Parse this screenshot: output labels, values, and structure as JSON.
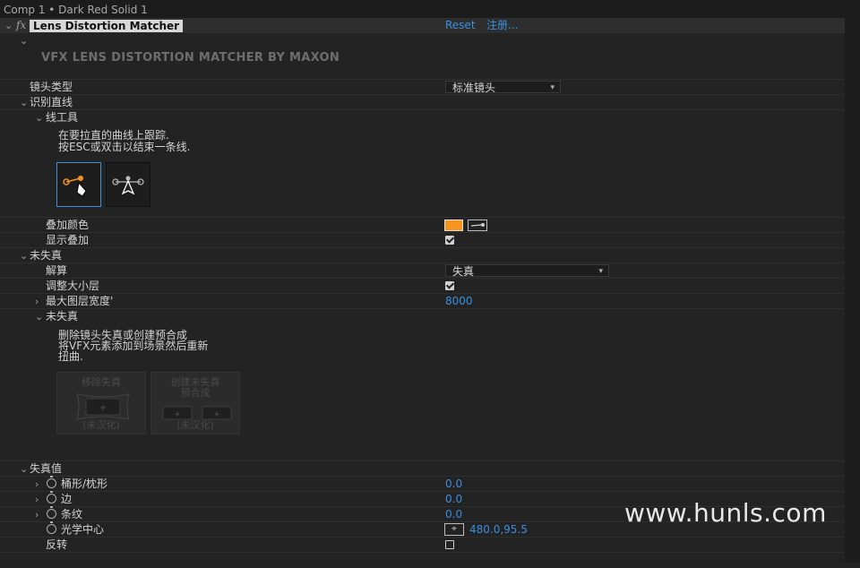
{
  "window": {
    "title": "Comp 1 • Dark Red Solid 1"
  },
  "effect": {
    "fx_icon": "fx",
    "name": "Lens Distortion Matcher",
    "reset": "Reset",
    "register": "注册...",
    "brand": "VFX LENS DISTORTION MATCHER BY MAXON"
  },
  "lens_type": {
    "label": "镜头类型",
    "value": "标准镜头"
  },
  "identify_lines": {
    "label": "识别直线",
    "line_tool": {
      "label": "线工具",
      "instr1": "在要拉直的曲线上跟踪.",
      "instr2": "按ESC或双击以结束一条线."
    },
    "overlay_color": {
      "label": "叠加颜色",
      "color": "#f7941d"
    },
    "show_overlay": {
      "label": "显示叠加",
      "checked": true
    }
  },
  "undistort": {
    "label": "未失真",
    "solve": {
      "label": "解算",
      "value": "失真"
    },
    "resize_layer": {
      "label": "调整大小层",
      "checked": true
    },
    "max_layer_width": {
      "label": "最大图层宽度'",
      "value": "8000"
    },
    "sub": {
      "label": "未失真",
      "desc1": "删除镜头失真或创建预合成",
      "desc2": "将VFX元素添加到场景然后重新",
      "desc3": "扭曲.",
      "btn_remove": {
        "t1": "移除失真",
        "t2": "(未汉化)"
      },
      "btn_create": {
        "t1": "创建未失真",
        "t1b": "预合成",
        "t2": "(未汉化)"
      }
    }
  },
  "distortion": {
    "label": "失真值",
    "barrel": {
      "label": "桶形/枕形",
      "value": "0.0"
    },
    "edge": {
      "label": "边",
      "value": "0.0"
    },
    "stripe": {
      "label": "条纹",
      "value": "0.0"
    },
    "optical_center": {
      "label": "光学中心",
      "value": "480.0,95.5"
    },
    "invert": {
      "label": "反转",
      "checked": false
    }
  },
  "watermark": "www.hunls.com"
}
